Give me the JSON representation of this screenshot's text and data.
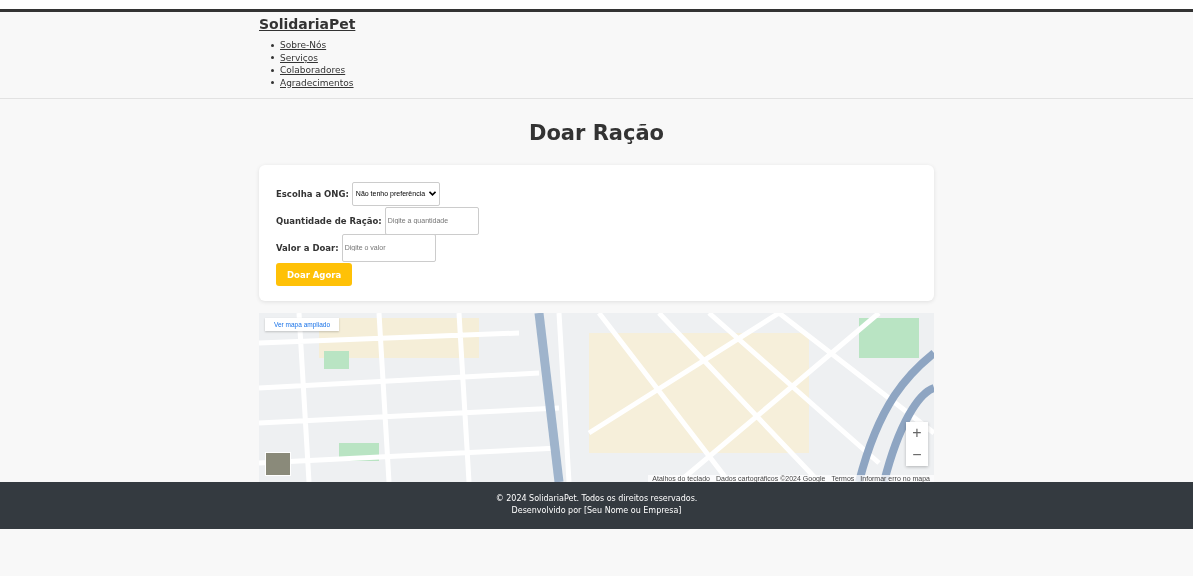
{
  "header": {
    "logo": "SolidariaPet",
    "nav": [
      "Sobre-Nós",
      "Serviços",
      "Colaboradores",
      "Agradecimentos"
    ]
  },
  "page_title": "Doar Ração",
  "form": {
    "fields": [
      {
        "kind": "select",
        "label": "Escolha a ONG:",
        "value": "Não tenho preferência"
      },
      {
        "kind": "input",
        "label": "Quantidade de Ração:",
        "placeholder": "Digite a quantidade"
      },
      {
        "kind": "input",
        "label": "Valor a Doar:",
        "placeholder": "Digite o valor"
      }
    ],
    "submit": "Doar Agora"
  },
  "map": {
    "enlarge_link": "Ver mapa ampliado",
    "zoom_in": "+",
    "zoom_out": "−",
    "attribution": [
      "Atalhos do teclado",
      "Dados cartográficos ©2024 Google",
      "Termos",
      "Informar erro no mapa"
    ]
  },
  "footer": {
    "lines": [
      "© 2024 SolidariaPet. Todos os direitos reservados.",
      "Desenvolvido por [Seu Nome ou Empresa]"
    ]
  }
}
